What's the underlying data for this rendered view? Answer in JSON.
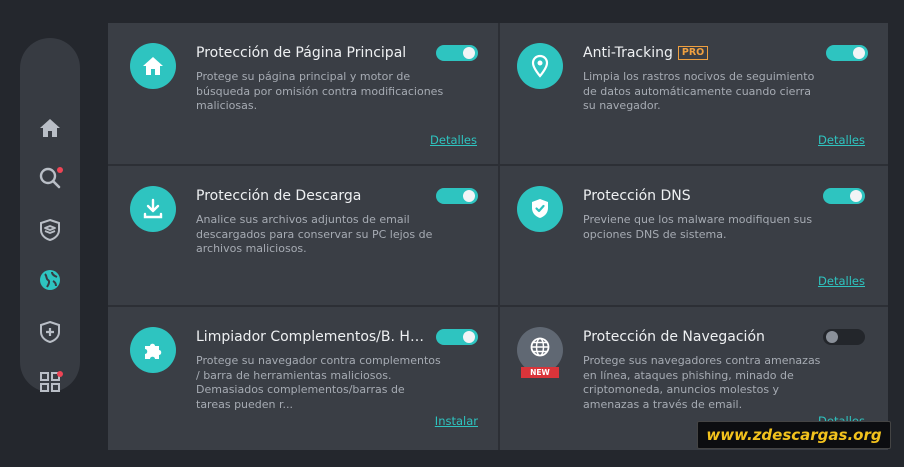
{
  "sidebar": {
    "items": [
      {
        "name": "home",
        "icon": "home-icon",
        "active": false,
        "badge": false
      },
      {
        "name": "search",
        "icon": "search-icon",
        "active": false,
        "badge": true
      },
      {
        "name": "layers",
        "icon": "layers-shield-icon",
        "active": false,
        "badge": false
      },
      {
        "name": "browser",
        "icon": "globe-icon",
        "active": true,
        "badge": false
      },
      {
        "name": "shield-plus",
        "icon": "shield-plus-icon",
        "active": false,
        "badge": false
      },
      {
        "name": "apps",
        "icon": "apps-grid-icon",
        "active": false,
        "badge": true
      }
    ]
  },
  "cards": [
    {
      "title": "Protección de Página Principal",
      "pro": false,
      "desc": "Protege su página principal y motor de búsqueda por omisión contra modificaciones maliciosas.",
      "toggle": true,
      "link": "Detalles",
      "icon": "home-icon"
    },
    {
      "title": "Anti-Tracking",
      "pro": true,
      "pro_label": "PRO",
      "desc": "Limpia los rastros nocivos de seguimiento de datos automáticamente cuando cierra su navegador.",
      "toggle": true,
      "link": "Detalles",
      "icon": "location-pin-icon"
    },
    {
      "title": "Protección de Descarga",
      "pro": false,
      "desc": "Analice sus archivos adjuntos de email descargados para conservar su PC lejos de archivos maliciosos.",
      "toggle": true,
      "link": "Detalles",
      "icon": "download-icon"
    },
    {
      "title": "Protección DNS",
      "pro": false,
      "desc": "Previene que los malware modifiquen sus opciones DNS de sistema.",
      "toggle": true,
      "link": "Detalles",
      "icon": "shield-check-icon"
    },
    {
      "title": "Limpiador Complementos/B. Herramientas",
      "pro": false,
      "desc": "Protege su navegador contra complementos / barra de herramientas maliciosos. Demasiados complementos/barras de tareas pueden r...",
      "toggle": true,
      "link": "Instalar",
      "icon": "puzzle-icon"
    },
    {
      "title": "Protección de Navegación",
      "pro": false,
      "desc": "Protege sus navegadores contra amenazas en línea, ataques phishing, minado de criptomoneda, anuncios molestos y amenazas a través de email.",
      "toggle": false,
      "link": "Detalles",
      "icon": "globe-new-icon",
      "new_label": "NEW"
    }
  ],
  "watermark": "www.zdescargas.org",
  "colors": {
    "accent": "#2ec4c0",
    "card": "#3a3e45",
    "badge": "#ee4455",
    "pro": "#f0a040",
    "watermark": "#f2c21d"
  }
}
